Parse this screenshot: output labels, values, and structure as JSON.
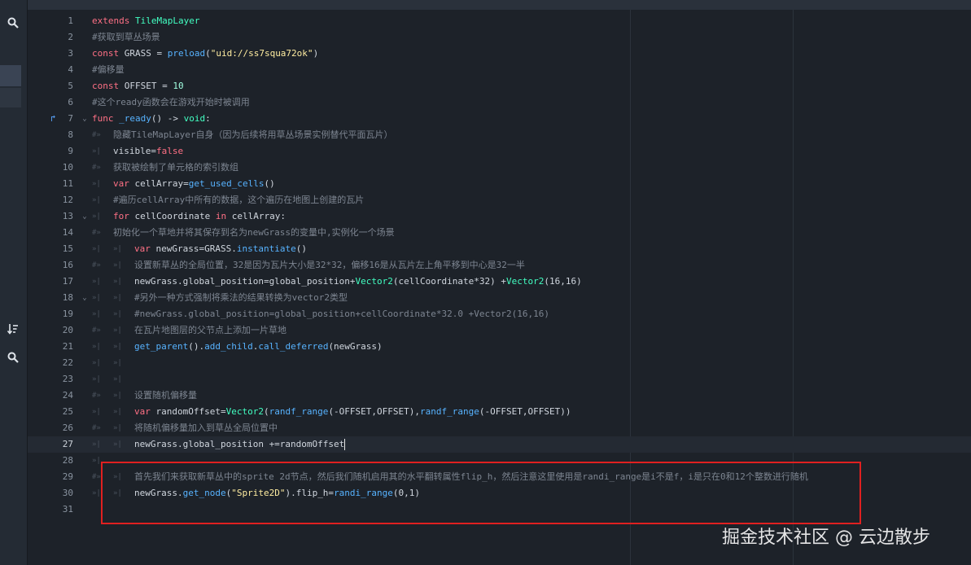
{
  "sidebar": {
    "icons": [
      "search-icon",
      "sort-icon",
      "search-icon"
    ]
  },
  "editor": {
    "current_line": 27,
    "lines": [
      {
        "n": "1",
        "tokens": [
          [
            "extends",
            "k"
          ],
          [
            " TileMapLayer",
            "t"
          ]
        ]
      },
      {
        "n": "2",
        "tokens": [
          [
            "#获取到草丛场景",
            "c"
          ]
        ]
      },
      {
        "n": "3",
        "tokens": [
          [
            "const",
            "k"
          ],
          [
            " GRASS = ",
            "p"
          ],
          [
            "preload",
            "f"
          ],
          [
            "(",
            "p"
          ],
          [
            "\"uid://ss7squa72ok\"",
            "s"
          ],
          [
            ")",
            "p"
          ]
        ]
      },
      {
        "n": "4",
        "tokens": [
          [
            "#偏移量",
            "c"
          ]
        ]
      },
      {
        "n": "5",
        "tokens": [
          [
            "const",
            "k"
          ],
          [
            " OFFSET = ",
            "p"
          ],
          [
            "10",
            "n"
          ]
        ]
      },
      {
        "n": "6",
        "tokens": [
          [
            "#这个ready函数会在游戏开始时被调用",
            "c"
          ]
        ]
      },
      {
        "n": "7",
        "fold": true,
        "icon": true,
        "tokens": [
          [
            "func",
            "k"
          ],
          [
            " _ready",
            "f"
          ],
          [
            "() -> ",
            "p"
          ],
          [
            "void",
            "t"
          ],
          [
            ":",
            "p"
          ]
        ]
      },
      {
        "n": "8",
        "indent": 1,
        "comment_mark": true,
        "tokens": [
          [
            "隐藏TileMapLayer自身（因为后续将用草丛场景实例替代平面瓦片）",
            "c"
          ]
        ]
      },
      {
        "n": "9",
        "indent": 1,
        "tokens": [
          [
            "visible",
            "p"
          ],
          [
            "=",
            "p"
          ],
          [
            "false",
            "k"
          ]
        ]
      },
      {
        "n": "10",
        "indent": 1,
        "comment_mark": true,
        "tokens": [
          [
            "获取被绘制了单元格的索引数组",
            "c"
          ]
        ]
      },
      {
        "n": "11",
        "indent": 1,
        "tokens": [
          [
            "var",
            "k"
          ],
          [
            " cellArray=",
            "p"
          ],
          [
            "get_used_cells",
            "f"
          ],
          [
            "()",
            "p"
          ]
        ]
      },
      {
        "n": "12",
        "indent": 1,
        "tokens": [
          [
            "#遍历cellArray中所有的数据，这个遍历在地图上创建的瓦片",
            "c"
          ]
        ]
      },
      {
        "n": "13",
        "indent": 1,
        "fold": true,
        "tokens": [
          [
            "for",
            "k"
          ],
          [
            " cellCoordinate ",
            "p"
          ],
          [
            "in",
            "k"
          ],
          [
            " cellArray:",
            "p"
          ]
        ]
      },
      {
        "n": "14",
        "indent": 1,
        "comment_mark": true,
        "tokens": [
          [
            "初始化一个草地并将其保存到名为newGrass的变量中,实例化一个场景",
            "c"
          ]
        ]
      },
      {
        "n": "15",
        "indent": 2,
        "tokens": [
          [
            "var",
            "k"
          ],
          [
            " newGrass=GRASS.",
            "p"
          ],
          [
            "instantiate",
            "f"
          ],
          [
            "()",
            "p"
          ]
        ]
      },
      {
        "n": "16",
        "indent": 2,
        "comment_mark": true,
        "tokens": [
          [
            "设置新草丛的全局位置，32是因为瓦片大小是32*32，偏移16是从瓦片左上角平移到中心是32一半",
            "c"
          ]
        ]
      },
      {
        "n": "17",
        "indent": 2,
        "tokens": [
          [
            "newGrass.global_position=global_position+",
            "p"
          ],
          [
            "Vector2",
            "t"
          ],
          [
            "(cellCoordinate*32) +",
            "p"
          ],
          [
            "Vector2",
            "t"
          ],
          [
            "(16,16)",
            "p"
          ]
        ]
      },
      {
        "n": "18",
        "indent": 2,
        "fold": true,
        "tokens": [
          [
            "#另外一种方式强制将乘法的结果转换为vector2类型",
            "c"
          ]
        ]
      },
      {
        "n": "19",
        "indent": 2,
        "tokens": [
          [
            "#newGrass.global_position=global_position+cellCoordinate*32.0 +Vector2(16,16)",
            "c"
          ]
        ]
      },
      {
        "n": "20",
        "indent": 2,
        "comment_mark": true,
        "tokens": [
          [
            "在瓦片地图层的父节点上添加一片草地",
            "c"
          ]
        ]
      },
      {
        "n": "21",
        "indent": 2,
        "tokens": [
          [
            "get_parent",
            "f"
          ],
          [
            "().",
            "p"
          ],
          [
            "add_child",
            "f"
          ],
          [
            ".",
            "p"
          ],
          [
            "call_deferred",
            "f"
          ],
          [
            "(newGrass)",
            "p"
          ]
        ]
      },
      {
        "n": "22",
        "indent": 2,
        "tokens": []
      },
      {
        "n": "23",
        "indent": 2,
        "tokens": []
      },
      {
        "n": "24",
        "indent": 2,
        "comment_mark": true,
        "tokens": [
          [
            "设置随机偏移量",
            "c"
          ]
        ]
      },
      {
        "n": "25",
        "indent": 2,
        "tokens": [
          [
            "var",
            "k"
          ],
          [
            " randomOffset=",
            "p"
          ],
          [
            "Vector2",
            "t"
          ],
          [
            "(",
            "p"
          ],
          [
            "randf_range",
            "f"
          ],
          [
            "(-OFFSET,OFFSET),",
            "p"
          ],
          [
            "randf_range",
            "f"
          ],
          [
            "(-OFFSET,OFFSET))",
            "p"
          ]
        ]
      },
      {
        "n": "26",
        "indent": 2,
        "comment_mark": true,
        "tokens": [
          [
            "将随机偏移量加入到草丛全局位置中",
            "c"
          ]
        ]
      },
      {
        "n": "27",
        "indent": 2,
        "cursor": true,
        "tokens": [
          [
            "newGrass.global_position +=randomOffset",
            "p"
          ]
        ]
      },
      {
        "n": "28",
        "indent": 1,
        "tokens": []
      },
      {
        "n": "29",
        "indent": 2,
        "comment_mark": true,
        "tokens": [
          [
            "首先我们来获取新草丛中的sprite 2d节点，然后我们随机启用其的水平翻转属性flip_h，然后注意这里使用是randi_range是i不是f，i是只在0和12个整数进行随机",
            "c"
          ]
        ]
      },
      {
        "n": "30",
        "indent": 2,
        "tokens": [
          [
            "newGrass.",
            "p"
          ],
          [
            "get_node",
            "f"
          ],
          [
            "(",
            "p"
          ],
          [
            "\"Sprite2D\"",
            "s"
          ],
          [
            ").flip_h=",
            "p"
          ],
          [
            "randi_range",
            "f"
          ],
          [
            "(0,1)",
            "p"
          ]
        ]
      },
      {
        "n": "31",
        "tokens": []
      }
    ]
  },
  "watermark": "掘金技术社区 @ 云边散步"
}
